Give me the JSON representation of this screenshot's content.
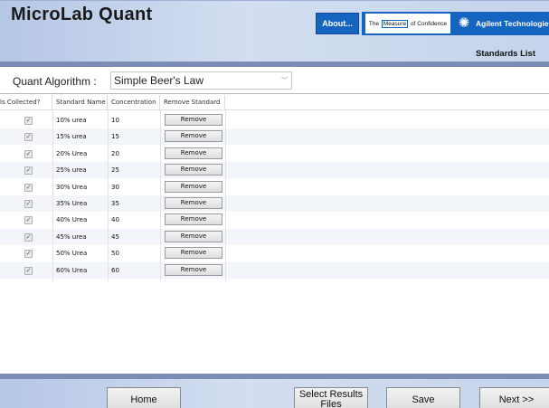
{
  "header": {
    "app_title": "MicroLab Quant",
    "about_label": "About...",
    "tagline_pre": "The",
    "tagline_measure": "Measure",
    "tagline_post": "of Confidence",
    "company": "Agilent Technologies",
    "page_label": "Standards List"
  },
  "algorithm": {
    "label": "Quant Algorithm :",
    "selected": "Simple Beer's Law"
  },
  "table": {
    "columns": [
      "Is Collected?",
      "Standard Name",
      "Concentration",
      "Remove Standard"
    ],
    "rows": [
      {
        "collected": "✓",
        "name": "10% urea",
        "concentration": "10",
        "action": "Remove"
      },
      {
        "collected": "✓",
        "name": "15% urea",
        "concentration": "15",
        "action": "Remove"
      },
      {
        "collected": "✓",
        "name": "20% Urea",
        "concentration": "20",
        "action": "Remove"
      },
      {
        "collected": "✓",
        "name": "25% urea",
        "concentration": "25",
        "action": "Remove"
      },
      {
        "collected": "✓",
        "name": "30% Urea",
        "concentration": "30",
        "action": "Remove"
      },
      {
        "collected": "✓",
        "name": "35% Urea",
        "concentration": "35",
        "action": "Remove"
      },
      {
        "collected": "✓",
        "name": "40% Urea",
        "concentration": "40",
        "action": "Remove"
      },
      {
        "collected": "✓",
        "name": "45% urea",
        "concentration": "45",
        "action": "Remove"
      },
      {
        "collected": "✓",
        "name": "50% Urea",
        "concentration": "50",
        "action": "Remove"
      },
      {
        "collected": "✓",
        "name": "60% Urea",
        "concentration": "60",
        "action": "Remove"
      }
    ]
  },
  "footer": {
    "home_label": "Home",
    "select_results_label": "Select Results Files",
    "save_label": "Save",
    "next_label": "Next >>"
  },
  "icons": {
    "brand": "agilent-spark-icon",
    "dropdown": "chevron-down-icon",
    "check": "checkmark-icon"
  },
  "colors": {
    "header_gradient": "#c5d4ec",
    "separator": "#7b8db4",
    "brand_blue": "#1565c0",
    "row_alt": "#f2f5fa"
  }
}
